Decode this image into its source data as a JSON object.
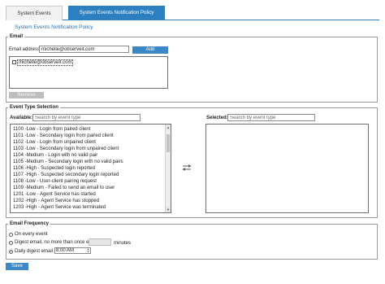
{
  "tabs": [
    {
      "label": "System Events"
    },
    {
      "label": "System Events Notification Policy"
    }
  ],
  "page_title": "System Events Notification Policy",
  "email": {
    "legend": "Email",
    "address_label": "Email address",
    "address_value": "michelle@observeit.com",
    "add_label": "Add",
    "list": [
      "michelle@observeit.com"
    ],
    "remove_label": "Remove"
  },
  "event_type": {
    "legend": "Event Type Selection",
    "available_label": "Available:",
    "available_placeholder": "Search by event type",
    "selected_label": "Selected:",
    "selected_placeholder": "Search by event type",
    "available_items": [
      "1100 -Low - Login from paired client",
      "1101 -Low - Secondary login from paired client",
      "1102 -Low - Login from unpaired client",
      "1103 -Low - Secondary login from unpaired client",
      "1104 -Medium - Login with no valid pair",
      "1105 -Medium - Secondary login with no valid pairs",
      "1106 -High - Suspected login reported",
      "1107 -High - Suspected secondary login reported",
      "1108 -Low - User-client pairing request",
      "1109 -Medium - Failed to send an email to user",
      "1201 -Low - Agent Service has started",
      "1202 -High - Agent Service has stopped",
      "1203 -High - Agent Service was terminated"
    ],
    "move_icon": "double-arrow-icon"
  },
  "frequency": {
    "legend": "Email Frequency",
    "option_every": "On every event",
    "option_digest": "Digest email, no more than once every",
    "digest_unit": "minutes",
    "digest_minutes_value": "",
    "option_daily": "Daily digest email at",
    "daily_time": "8:00 AM",
    "selected": "daily"
  },
  "save_label": "Save",
  "colors": {
    "accent": "#2c7fc0",
    "button": "#3c88c6",
    "title": "#2a6fb2"
  }
}
